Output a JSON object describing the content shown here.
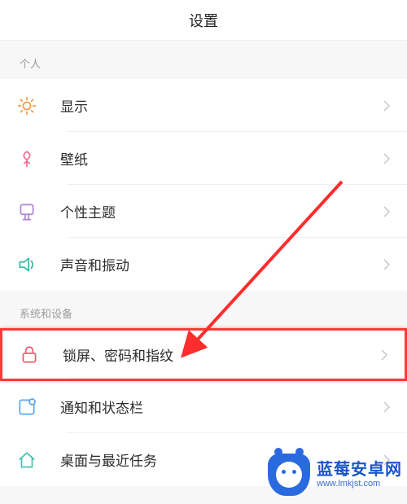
{
  "header": {
    "title": "设置"
  },
  "sections": [
    {
      "label": "个人",
      "items": [
        {
          "label": "显示",
          "icon": "sun-icon"
        },
        {
          "label": "壁纸",
          "icon": "wallpaper-icon"
        },
        {
          "label": "个性主题",
          "icon": "theme-icon"
        },
        {
          "label": "声音和振动",
          "icon": "sound-icon"
        }
      ]
    },
    {
      "label": "系统和设备",
      "items": [
        {
          "label": "锁屏、密码和指纹",
          "icon": "lock-icon",
          "highlighted": true
        },
        {
          "label": "通知和状态栏",
          "icon": "notification-icon"
        },
        {
          "label": "桌面与最近任务",
          "icon": "home-icon"
        }
      ]
    }
  ],
  "watermark": {
    "line1": "蓝莓安卓网",
    "line2": "www.lmkjst.com"
  },
  "colors": {
    "sun": "#f39b47",
    "tulip": "#ef6f8f",
    "theme": "#b083d6",
    "sound": "#3fb5a8",
    "lock": "#ef5a6b",
    "notif": "#5aa6e8",
    "home": "#49c1b5",
    "arrow": "#ff2d2d"
  }
}
